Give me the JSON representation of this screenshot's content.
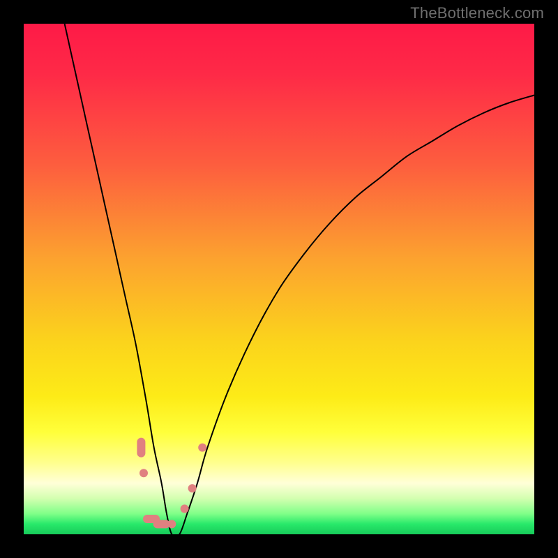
{
  "watermark": "TheBottleneck.com",
  "colors": {
    "frame": "#000000",
    "gradient_top": "#fe1a47",
    "gradient_mid": "#fbd31c",
    "gradient_bottom": "#17cb5a",
    "curve": "#000000",
    "dots": "#e08080",
    "watermark": "#6f6f6f"
  },
  "chart_data": {
    "type": "line",
    "title": "",
    "xlabel": "",
    "ylabel": "",
    "xlim": [
      0,
      100
    ],
    "ylim": [
      0,
      100
    ],
    "series": [
      {
        "name": "bottleneck-curve",
        "x": [
          8,
          10,
          12,
          14,
          16,
          18,
          20,
          22,
          24,
          25.5,
          27,
          28,
          29,
          30.5,
          32,
          34,
          36,
          40,
          45,
          50,
          55,
          60,
          65,
          70,
          75,
          80,
          85,
          90,
          95,
          100
        ],
        "y": [
          100,
          91,
          82,
          73,
          64,
          55,
          46,
          37,
          26,
          17,
          10,
          4,
          0,
          0,
          4,
          10,
          17,
          28,
          39,
          48,
          55,
          61,
          66,
          70,
          74,
          77,
          80,
          82.5,
          84.5,
          86
        ]
      }
    ],
    "markers": [
      {
        "x": 23.0,
        "y": 17,
        "shape": "pill-v"
      },
      {
        "x": 23.5,
        "y": 12,
        "shape": "dot"
      },
      {
        "x": 25.0,
        "y": 3,
        "shape": "pill-h"
      },
      {
        "x": 27.0,
        "y": 2,
        "shape": "pill-h"
      },
      {
        "x": 29.0,
        "y": 2,
        "shape": "dot"
      },
      {
        "x": 31.5,
        "y": 5,
        "shape": "dot"
      },
      {
        "x": 33.0,
        "y": 9,
        "shape": "dot"
      },
      {
        "x": 35.0,
        "y": 17,
        "shape": "dot"
      }
    ],
    "note": "x,y are percentages of the plot area (0,0 = bottom-left). Values estimated from pixels."
  }
}
